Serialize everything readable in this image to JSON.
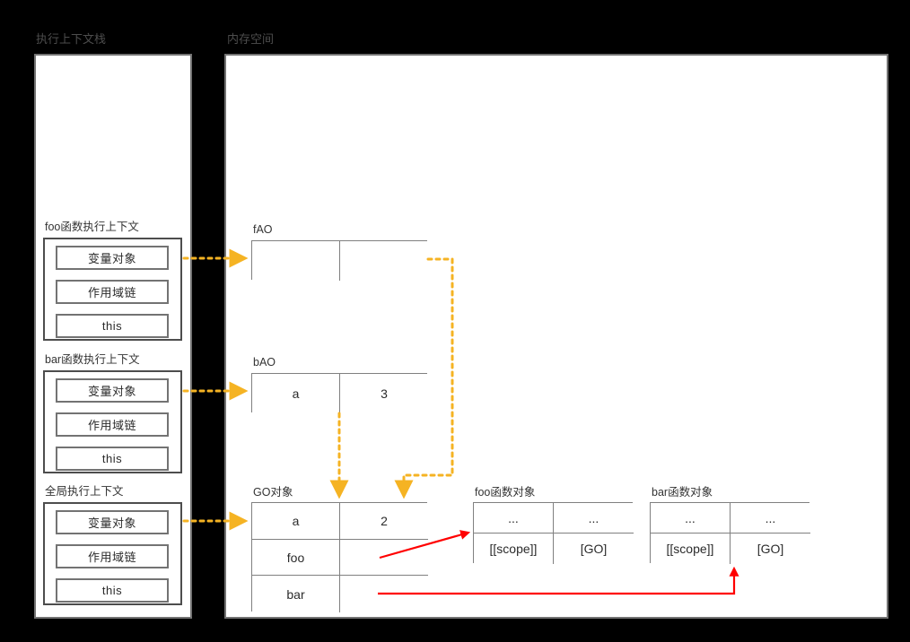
{
  "colors": {
    "background": "#000000",
    "panel_fill": "#ffffff",
    "panel_border": "#737373",
    "box_border": "#4d4d4d",
    "table_border": "#808080",
    "connector_orange": "#f5b323",
    "connector_red": "#ff0000",
    "text": "#2b2b2b",
    "label_text": "#4d4d4d"
  },
  "panels": {
    "stack": {
      "title": "执行上下文栈"
    },
    "memory": {
      "title": "内存空间"
    }
  },
  "contexts": [
    {
      "label": "foo函数执行上下文",
      "slots": [
        "变量对象",
        "作用域链",
        "this"
      ]
    },
    {
      "label": "bar函数执行上下文",
      "slots": [
        "变量对象",
        "作用域链",
        "this"
      ]
    },
    {
      "label": "全局执行上下文",
      "slots": [
        "变量对象",
        "作用域链",
        "this"
      ]
    }
  ],
  "memory_objects": [
    {
      "label": "fAO",
      "rows": [
        [
          "",
          ""
        ]
      ]
    },
    {
      "label": "bAO",
      "rows": [
        [
          "a",
          "3"
        ]
      ]
    },
    {
      "label": "GO对象",
      "rows": [
        [
          "a",
          "2"
        ],
        [
          "foo",
          ""
        ],
        [
          "bar",
          ""
        ]
      ]
    },
    {
      "label": "foo函数对象",
      "rows": [
        [
          "...",
          "..."
        ],
        [
          "[[scope]]",
          "[GO]"
        ]
      ]
    },
    {
      "label": "bar函数对象",
      "rows": [
        [
          "...",
          "..."
        ],
        [
          "[[scope]]",
          "[GO]"
        ]
      ]
    }
  ],
  "connectors": [
    {
      "name": "foo-vo-to-fao",
      "style": "dotted",
      "color": "#f5b323"
    },
    {
      "name": "bar-vo-to-bao",
      "style": "dotted",
      "color": "#f5b323"
    },
    {
      "name": "global-vo-to-go",
      "style": "dotted",
      "color": "#f5b323"
    },
    {
      "name": "bao-to-go",
      "style": "dotted",
      "color": "#f5b323"
    },
    {
      "name": "fao-to-go",
      "style": "dotted",
      "color": "#f5b323"
    },
    {
      "name": "go-foo-to-foo-function-object",
      "style": "solid",
      "color": "#ff0000"
    },
    {
      "name": "go-bar-to-bar-function-object",
      "style": "solid",
      "color": "#ff0000"
    }
  ]
}
